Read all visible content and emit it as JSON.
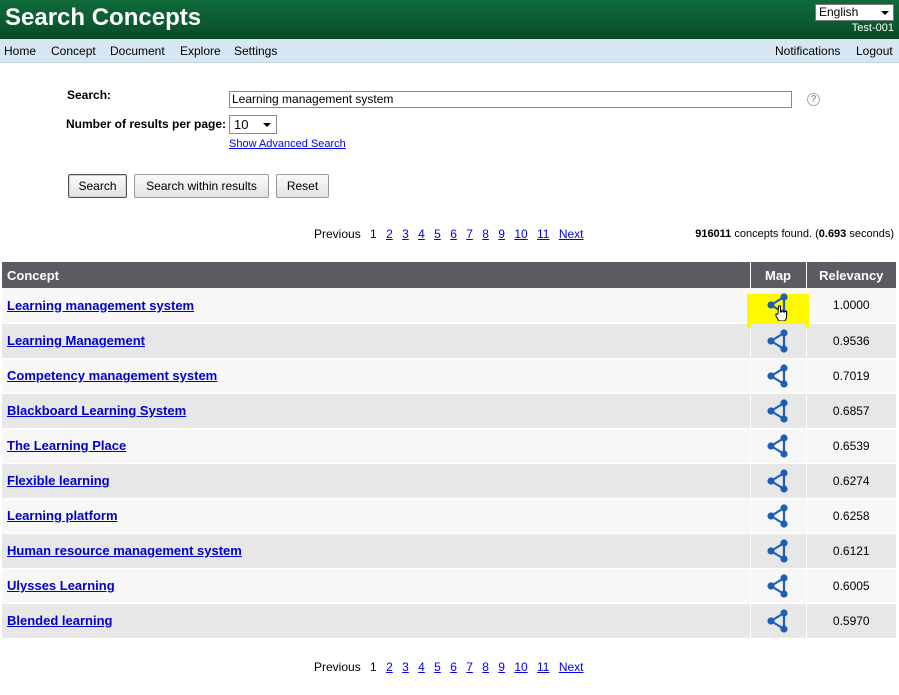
{
  "app": {
    "title": "Search Concepts",
    "language": "English",
    "user": "Test-001"
  },
  "nav": {
    "left": [
      "Home",
      "Concept",
      "Document",
      "Explore",
      "Settings"
    ],
    "right": [
      "Notifications",
      "Logout"
    ]
  },
  "form": {
    "search_label": "Search:",
    "search_value": "Learning management system",
    "results_label": "Number of results per page:",
    "results_value": "10",
    "advanced_link": "Show Advanced Search",
    "help": "?",
    "buttons": {
      "search": "Search",
      "search_within": "Search within results",
      "reset": "Reset"
    }
  },
  "pagination": {
    "previous": "Previous",
    "current": "1",
    "pages": [
      "2",
      "3",
      "4",
      "5",
      "6",
      "7",
      "8",
      "9",
      "10",
      "11"
    ],
    "next": "Next"
  },
  "summary": {
    "count": "916011",
    "count_text": " concepts found. (",
    "seconds": "0.693",
    "seconds_text": " seconds)"
  },
  "table": {
    "headers": {
      "concept": "Concept",
      "map": "Map",
      "relevancy": "Relevancy"
    },
    "rows": [
      {
        "concept": "Learning management system",
        "relevancy": "1.0000"
      },
      {
        "concept": "Learning Management",
        "relevancy": "0.9536"
      },
      {
        "concept": "Competency management system",
        "relevancy": "0.7019"
      },
      {
        "concept": "Blackboard Learning System",
        "relevancy": "0.6857"
      },
      {
        "concept": "The Learning Place",
        "relevancy": "0.6539"
      },
      {
        "concept": "Flexible learning",
        "relevancy": "0.6274"
      },
      {
        "concept": "Learning platform",
        "relevancy": "0.6258"
      },
      {
        "concept": "Human resource management system",
        "relevancy": "0.6121"
      },
      {
        "concept": "Ulysses Learning",
        "relevancy": "0.6005"
      },
      {
        "concept": "Blended learning",
        "relevancy": "0.5970"
      }
    ]
  },
  "icons": {
    "map": "network-map-icon",
    "help": "help-icon",
    "dropdown": "chevron-down-icon",
    "cursor": "hand-pointer-icon"
  },
  "colors": {
    "header": "#0b5a30",
    "nav": "#d6e7f3",
    "table_header": "#5b5b62",
    "link": "#0000cc",
    "highlight": "#fff900",
    "map_icon": "#1e5fb5"
  }
}
